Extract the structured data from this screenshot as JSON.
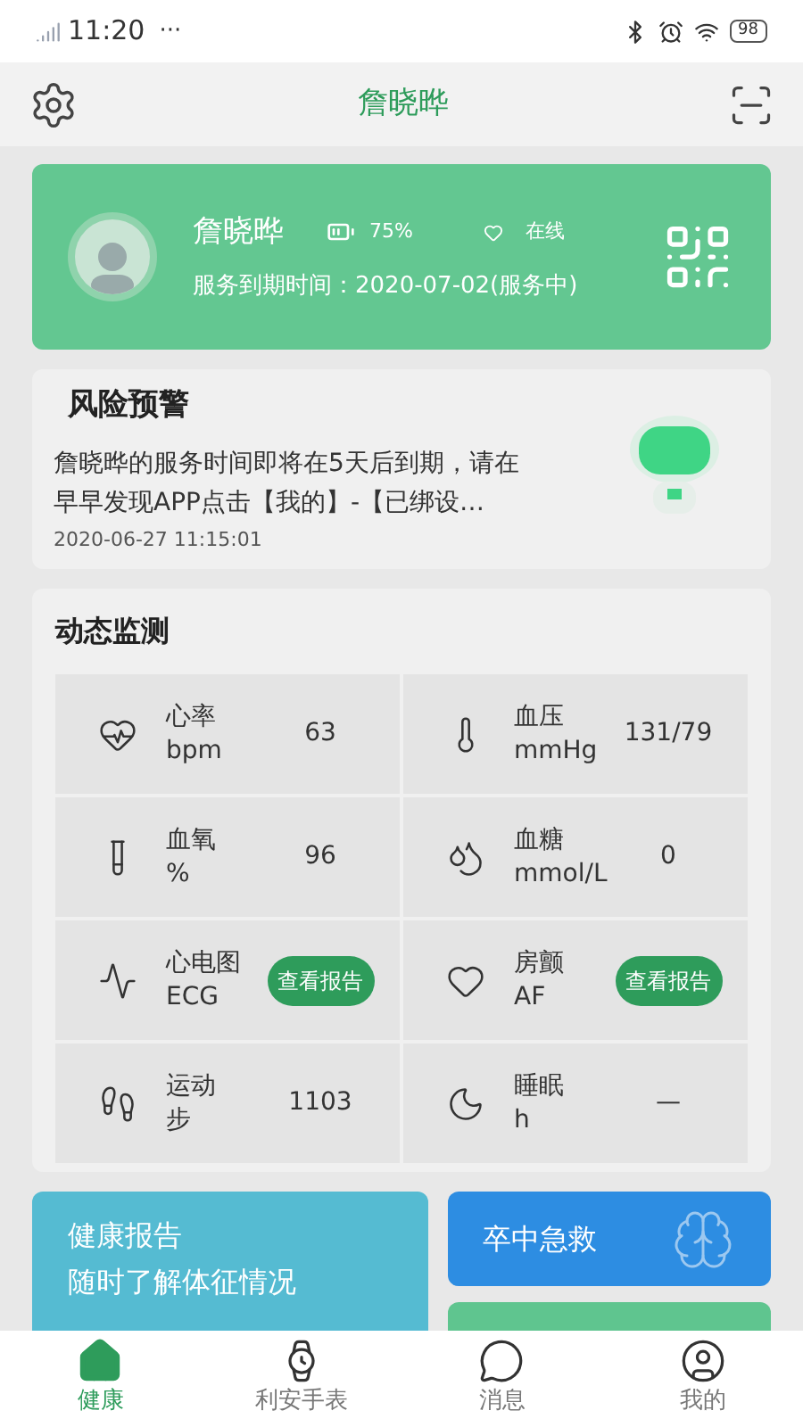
{
  "status_bar": {
    "time": "11:20",
    "more": "···",
    "battery": "98"
  },
  "header": {
    "title": "詹晓晔"
  },
  "profile": {
    "name": "詹晓晔",
    "battery": "75%",
    "status": "在线",
    "service": "服务到期时间：2020-07-02(服务中)"
  },
  "risk_alert": {
    "title": "风险预警",
    "message": "詹晓晔的服务时间即将在5天后到期，请在早早发现APP点击【我的】-【已绑设…",
    "time": "2020-06-27 11:15:01"
  },
  "monitoring": {
    "title": "动态监测",
    "metrics": [
      {
        "kind": "value",
        "label": "心率",
        "unit": "bpm",
        "value": "63"
      },
      {
        "kind": "value",
        "label": "血压",
        "unit": "mmHg",
        "value": "131/79"
      },
      {
        "kind": "value",
        "label": "血氧",
        "unit": "%",
        "value": "96"
      },
      {
        "kind": "value",
        "label": "血糖",
        "unit": "mmol/L",
        "value": "0"
      },
      {
        "kind": "report",
        "label": "心电图",
        "unit": "ECG",
        "button": "查看报告"
      },
      {
        "kind": "report",
        "label": "房颤",
        "unit": "AF",
        "button": "查看报告"
      },
      {
        "kind": "value",
        "label": "运动",
        "unit": "步",
        "value": "1103"
      },
      {
        "kind": "value",
        "label": "睡眠",
        "unit": "h",
        "value": "—"
      }
    ]
  },
  "cards": {
    "health_report": {
      "title": "健康报告",
      "subtitle": "随时了解体征情况"
    },
    "stroke": {
      "title": "卒中急救"
    }
  },
  "tabs": [
    {
      "label": "健康",
      "selected": true
    },
    {
      "label": "利安手表",
      "selected": false
    },
    {
      "label": "消息",
      "selected": false
    },
    {
      "label": "我的",
      "selected": false
    }
  ]
}
